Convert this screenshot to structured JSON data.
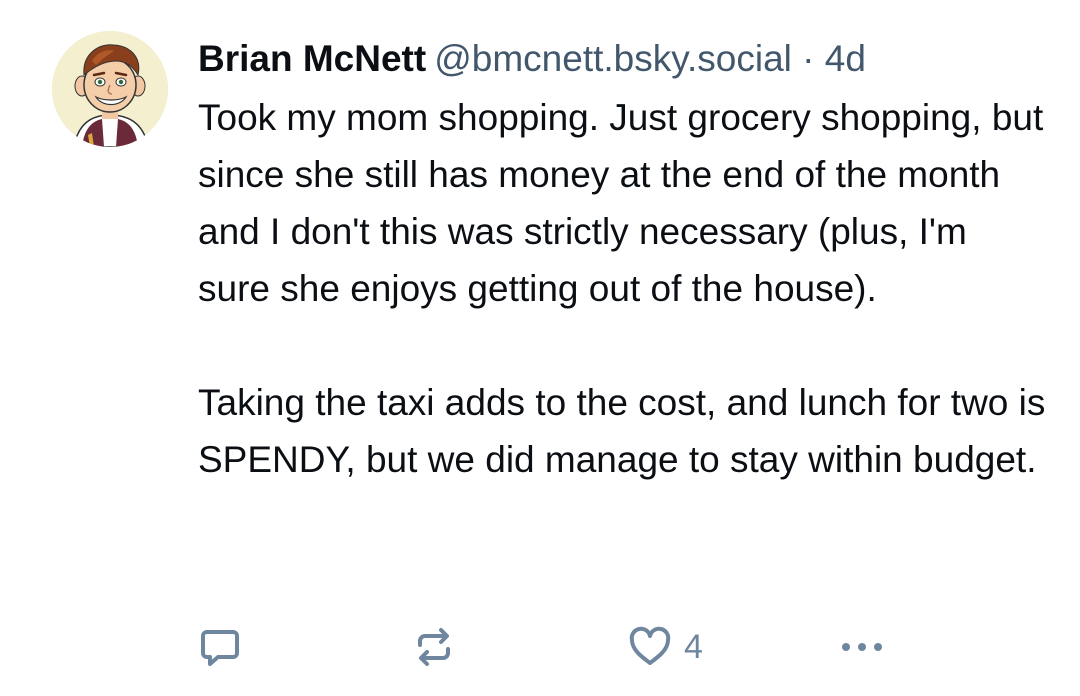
{
  "post": {
    "author": {
      "display_name": "Brian McNett",
      "handle": "@bmcnett.bsky.social",
      "avatar_icon": "cartoon-avatar"
    },
    "separator": "·",
    "time_ago": "4d",
    "paragraphs": [
      "Took my mom shopping. Just grocery shopping, but since she still has money at the end of the month and I don't this was strictly necessary (plus, I'm sure she enjoys getting out of the house).",
      "Taking the taxi adds to the cost, and lunch for two is SPENDY, but we did manage to stay within budget."
    ],
    "actions": {
      "reply_icon": "reply-icon",
      "repost_icon": "repost-icon",
      "like_icon": "heart-icon",
      "like_count": "4",
      "more_icon": "more-icon"
    },
    "colors": {
      "text": "#0b0f14",
      "secondary": "#42576c",
      "action": "#6f869f"
    }
  }
}
